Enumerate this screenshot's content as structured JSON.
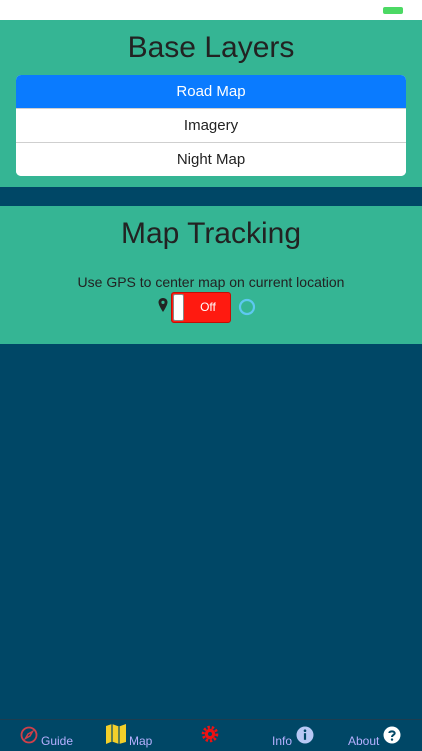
{
  "base_layers": {
    "title": "Base Layers",
    "options": [
      "Road Map",
      "Imagery",
      "Night Map"
    ],
    "selected": "Road Map"
  },
  "tracking": {
    "title": "Map Tracking",
    "caption": "Use GPS to center map on current location",
    "toggle_label": "Off"
  },
  "tabs": {
    "guide": "Guide",
    "map": "Map",
    "info": "Info",
    "about": "About"
  },
  "colors": {
    "panel_green": "#35b594",
    "background_navy": "#004766",
    "selected_blue": "#0a7bff",
    "toggle_red": "#ff1a10",
    "tab_label": "#b6b0ff"
  },
  "icons": [
    "battery-icon",
    "location-pin-icon",
    "gps-ring-icon",
    "compass-icon",
    "map-icon",
    "gear-icon",
    "info-icon",
    "help-icon"
  ]
}
